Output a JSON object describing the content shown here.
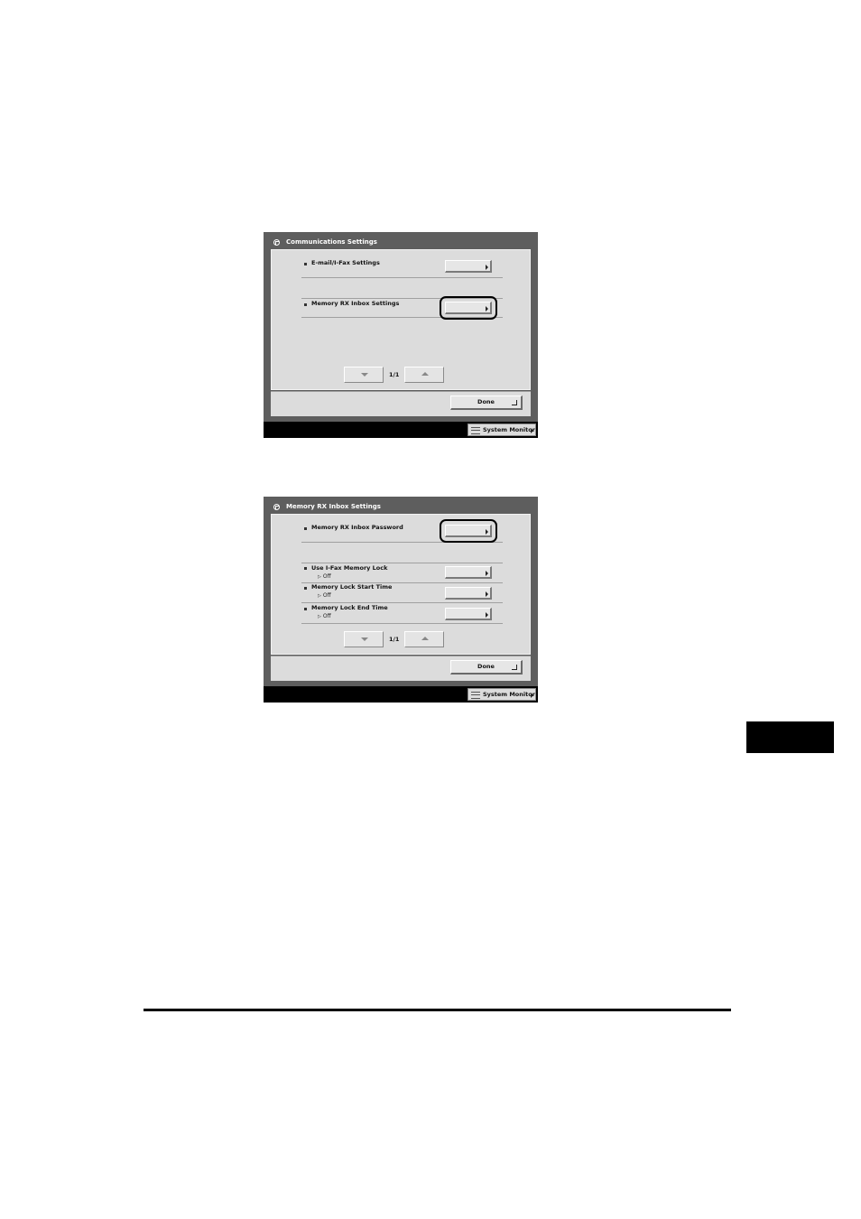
{
  "screen1": {
    "title": "Communications Settings",
    "rows": [
      {
        "label": "E-mail/I-Fax Settings"
      },
      {
        "label": "Memory RX Inbox Settings"
      }
    ],
    "pager": {
      "page": "1/1"
    },
    "done_label": "Done",
    "system_monitor_label": "System Monitor"
  },
  "screen2": {
    "title": "Memory RX Inbox Settings",
    "rows": [
      {
        "label": "Memory RX Inbox Password"
      },
      {
        "label": "Use I-Fax Memory Lock",
        "value": "Off"
      },
      {
        "label": "Memory Lock Start Time",
        "value": "Off"
      },
      {
        "label": "Memory Lock End Time",
        "value": "Off"
      }
    ],
    "pager": {
      "page": "1/1"
    },
    "done_label": "Done",
    "system_monitor_label": "System Monitor"
  }
}
